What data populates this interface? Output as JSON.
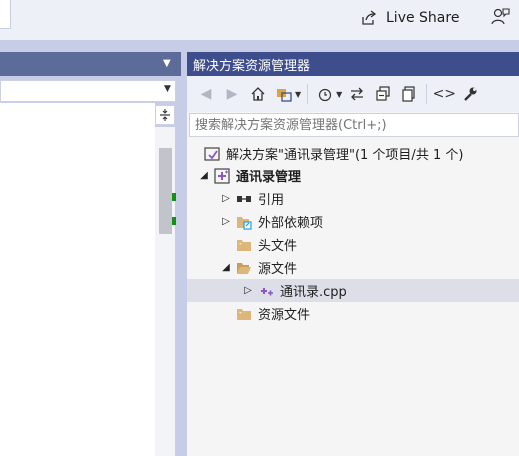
{
  "header": {
    "live_share_label": "Live Share"
  },
  "solution_explorer": {
    "title": "解决方案资源管理器",
    "search": {
      "placeholder": "搜索解决方案资源管理器(Ctrl+;)"
    },
    "tree": [
      {
        "label": "解决方案\"通讯录管理\"(1 个项目/共 1 个)",
        "icon": "solution-icon",
        "level": 0,
        "state": "none"
      },
      {
        "label": "通讯录管理",
        "icon": "cpp-project-icon",
        "level": 1,
        "state": "expanded",
        "bold": true
      },
      {
        "label": "引用",
        "icon": "references-icon",
        "level": 2,
        "state": "collapsed"
      },
      {
        "label": "外部依赖项",
        "icon": "external-deps-icon",
        "level": 2,
        "state": "collapsed"
      },
      {
        "label": "头文件",
        "icon": "folder-filter-icon",
        "level": 2,
        "state": "none"
      },
      {
        "label": "源文件",
        "icon": "folder-filter-open-icon",
        "level": 2,
        "state": "expanded"
      },
      {
        "label": "通讯录.cpp",
        "icon": "cpp-file-icon",
        "level": 3,
        "state": "collapsed",
        "selected": true
      },
      {
        "label": "资源文件",
        "icon": "folder-filter-icon",
        "level": 2,
        "state": "none"
      }
    ]
  },
  "colors": {
    "title_bar": "#3e4e8c",
    "frame": "#c7cde6",
    "selection": "#dcdfe8"
  }
}
